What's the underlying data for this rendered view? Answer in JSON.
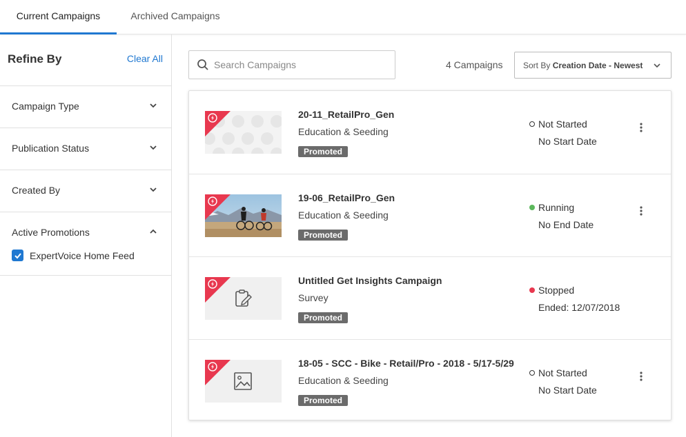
{
  "tabs": [
    {
      "label": "Current Campaigns",
      "active": true
    },
    {
      "label": "Archived Campaigns",
      "active": false
    }
  ],
  "sidebar": {
    "title": "Refine By",
    "clear_label": "Clear All",
    "filters": [
      {
        "label": "Campaign Type",
        "expanded": false
      },
      {
        "label": "Publication Status",
        "expanded": false
      },
      {
        "label": "Created By",
        "expanded": false
      },
      {
        "label": "Active Promotions",
        "expanded": true,
        "options": [
          {
            "label": "ExpertVoice Home Feed",
            "checked": true
          }
        ]
      }
    ]
  },
  "search": {
    "placeholder": "Search Campaigns",
    "value": ""
  },
  "count_label": "4 Campaigns",
  "sort": {
    "prefix": "Sort By",
    "value": "Creation Date - Newest"
  },
  "campaigns": [
    {
      "title": "20-11_RetailPro_Gen",
      "type": "Education & Seeding",
      "badge": "Promoted",
      "status": "Not Started",
      "status_color": "hollow",
      "date": "No Start Date",
      "thumb": "pattern"
    },
    {
      "title": "19-06_RetailPro_Gen",
      "type": "Education & Seeding",
      "badge": "Promoted",
      "status": "Running",
      "status_color": "#5cb85c",
      "date": "No End Date",
      "thumb": "photo-cyclists"
    },
    {
      "title": "Untitled Get Insights Campaign",
      "type": "Survey",
      "badge": "Promoted",
      "status": "Stopped",
      "status_color": "#e8384f",
      "date": "Ended: 12/07/2018",
      "thumb": "survey-icon"
    },
    {
      "title": "18-05 - SCC - Bike - Retail/Pro - 2018 - 5/17-5/29",
      "type": "Education & Seeding",
      "badge": "Promoted",
      "status": "Not Started",
      "status_color": "hollow",
      "date": "No Start Date",
      "thumb": "image-icon"
    }
  ],
  "colors": {
    "accent": "#1f78d1",
    "badge_red": "#e8384f",
    "promoted_bg": "#6b6b6b"
  }
}
